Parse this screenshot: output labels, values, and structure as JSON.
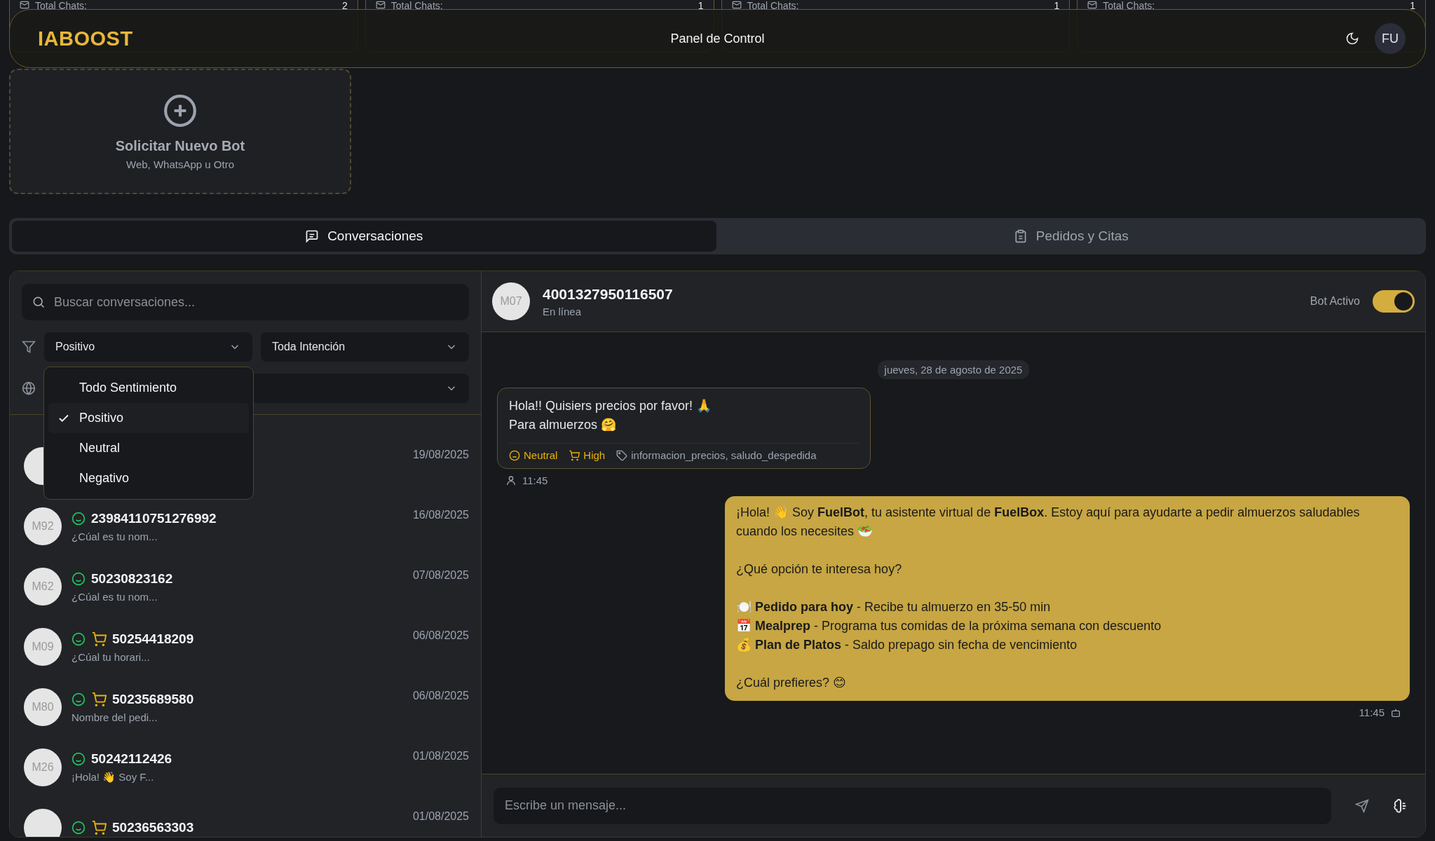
{
  "stats": [
    {
      "label": "Total Chats:",
      "value": "2"
    },
    {
      "label": "Total Chats:",
      "value": "1"
    },
    {
      "label": "Total Chats:",
      "value": "1"
    },
    {
      "label": "Total Chats:",
      "value": "1"
    }
  ],
  "header": {
    "logo": "IABOOST",
    "title": "Panel de Control",
    "avatar": "FU"
  },
  "new_bot_card": {
    "title": "Solicitar Nuevo Bot",
    "subtitle": "Web, WhatsApp u Otro"
  },
  "tabs": [
    {
      "label": "Conversaciones",
      "selected": true,
      "kind": "chat"
    },
    {
      "label": "Pedidos y Citas",
      "selected": false,
      "kind": "clipboard"
    }
  ],
  "conversation_list": {
    "search": {
      "placeholder": "Buscar conversaciones..."
    },
    "filters": [
      {
        "value": "Positivo"
      },
      {
        "value": "Toda Intención"
      }
    ],
    "sentiment_menu": {
      "options": [
        {
          "label": "Todo Sentimiento",
          "selected": false
        },
        {
          "label": "Positivo",
          "selected": true
        },
        {
          "label": "Neutral",
          "selected": false
        },
        {
          "label": "Negativo",
          "selected": false
        }
      ]
    },
    "conversations": [
      {
        "date": "19/08/2025"
      },
      {
        "avatar": "M92",
        "name": "23984110751276992",
        "preview": "¿Cúal es tu nom...",
        "date": "16/08/2025",
        "positive": true,
        "order": false
      },
      {
        "avatar": "M62",
        "name": "50230823162",
        "preview": "¿Cúal es tu nom...",
        "date": "07/08/2025",
        "positive": true,
        "order": false
      },
      {
        "avatar": "M09",
        "name": "50254418209",
        "preview": "¿Cúal tu horari...",
        "date": "06/08/2025",
        "positive": true,
        "order": true
      },
      {
        "avatar": "M80",
        "name": "50235689580",
        "preview": "Nombre del pedi...",
        "date": "06/08/2025",
        "positive": true,
        "order": true
      },
      {
        "avatar": "M26",
        "name": "50242112426",
        "preview": "¡Hola! 👋 Soy F...",
        "date": "01/08/2025",
        "positive": true,
        "order": false
      },
      {
        "name": "50236563303",
        "date": "01/08/2025",
        "positive": true,
        "order": true
      }
    ]
  },
  "chat": {
    "contact": {
      "avatar": "M07",
      "name": "4001327950116507",
      "status": "En línea"
    },
    "bot_toggle": {
      "label": "Bot Activo",
      "on": true
    },
    "date_divider": "jueves, 28 de agosto de 2025",
    "messages": [
      {
        "kind": "incoming",
        "paragraphs": [
          [
            "Hola!! Quisiers precios por favor! 🙏",
            "Para almuerzos 🤗"
          ]
        ],
        "sentiment": "Neutral",
        "purchase_intent": "High",
        "tags": "informacion_precios, saludo_despedida",
        "time": "11:45"
      },
      {
        "kind": "outgoing",
        "paragraphs": [
          [
            "¡Hola! 👋 Soy **FuelBot**, tu asistente virtual de **FuelBox**. Estoy aquí para ayudarte a pedir almuerzos saludables cuando los necesites 🥗"
          ],
          [
            "¿Qué opción te interesa hoy?"
          ],
          [
            "🍽️ **Pedido para hoy** - Recibe tu almuerzo en 35-50 min",
            "📅 **Mealprep** - Programa tus comidas de la próxima semana con descuento",
            "💰 **Plan de Platos** - Saldo prepago sin fecha de vencimiento"
          ],
          [
            "¿Cuál prefieres? 😊"
          ]
        ],
        "time": "11:45"
      }
    ],
    "composer": {
      "placeholder": "Escribe un mensaje..."
    }
  }
}
